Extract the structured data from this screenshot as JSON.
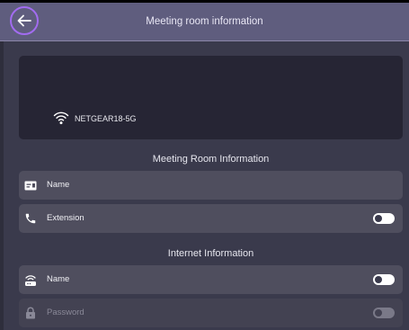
{
  "header": {
    "title": "Meeting room information",
    "back_icon": "arrow-left-icon"
  },
  "network_panel": {
    "ssid": "NETGEAR18-5G",
    "icon": "wifi-icon"
  },
  "meeting_section": {
    "title": "Meeting Room Information",
    "rows": [
      {
        "label": "Name",
        "icon": "id-card-icon"
      },
      {
        "label": "Extension",
        "icon": "phone-icon",
        "toggle_on": false
      }
    ]
  },
  "internet_section": {
    "title": "Internet Information",
    "rows": [
      {
        "label": "Name",
        "icon": "router-icon",
        "toggle_on": false
      },
      {
        "label": "Password",
        "icon": "lock-icon",
        "toggle_on": false,
        "disabled": true
      }
    ]
  },
  "colors": {
    "header_bg": "#5f5d7e",
    "page_bg": "#3a3a4c",
    "panel_bg": "#262534",
    "row_bg": "#4f4e5e",
    "back_ring": "#a26cf0"
  }
}
